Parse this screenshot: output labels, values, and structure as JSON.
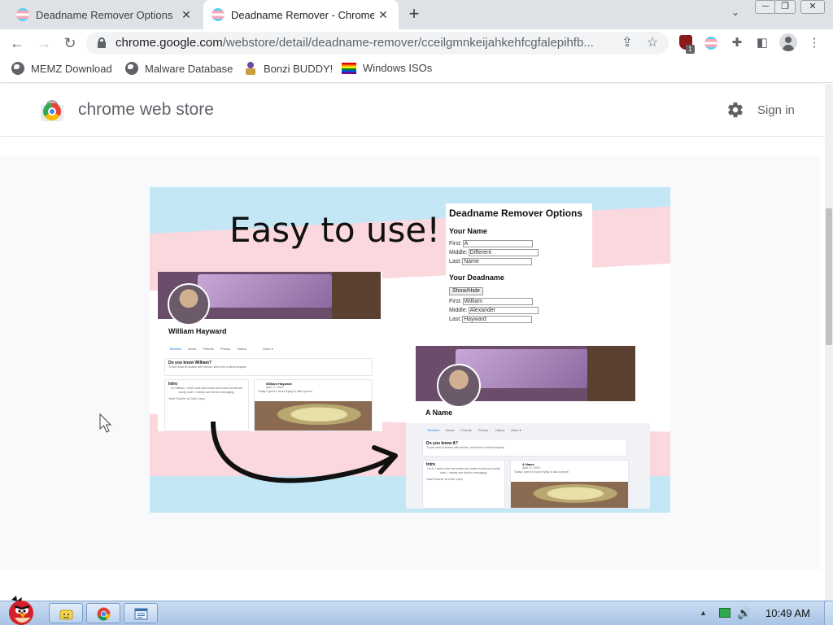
{
  "tabs": [
    {
      "title": "Deadname Remover Options",
      "active": false
    },
    {
      "title": "Deadname Remover - Chrome Web Store",
      "active": true
    }
  ],
  "toolbar": {
    "url_host": "chrome.google.com",
    "url_path": "/webstore/detail/deadname-remover/cceilgmnkeijahkehfcgfalepihfb...",
    "extension_badge": "1"
  },
  "bookmarks": [
    {
      "label": "MEMZ Download",
      "icon": "globe-icon"
    },
    {
      "label": "Malware Database",
      "icon": "globe-icon"
    },
    {
      "label": "Bonzi BUDDY!",
      "icon": "bonzi-icon"
    },
    {
      "label": "Windows ISOs",
      "icon": "rainbow-flag-icon"
    }
  ],
  "store": {
    "title": "chrome web store",
    "signin": "Sign in"
  },
  "promo": {
    "headline": "Easy to use!",
    "options": {
      "title": "Deadname Remover Options",
      "your_name": "Your Name",
      "first_label": "First:",
      "first_value": "A",
      "middle_label": "Middle:",
      "middle_value": "Different",
      "last_label": "Last:",
      "last_value": "Name",
      "your_deadname": "Your Deadname",
      "show_hide": "Show/Hide",
      "dead_first": "William",
      "dead_middle": "Alexander",
      "dead_last": "Hayward"
    },
    "profile_before": {
      "name": "William Hayward",
      "nav": [
        "Timeline",
        "About",
        "Friends",
        "Photos",
        "Videos",
        "More ▾"
      ],
      "know_title": "Do you know William?",
      "know_text": "To see what he shares with friends, send him a friend request.",
      "intro_title": "Intro",
      "intro_text": "I'm William. I write code and words and coded words and wordy code. I mainly use this for messaging.",
      "teacher": "Head Teacher at Code Camp",
      "post_name": "William Hayward",
      "post_date": "April 17, 2015",
      "post_text": "Today I spent 5 hours trying to dial a phone."
    },
    "profile_after": {
      "name": "A Name",
      "nav": [
        "Timeline",
        "About",
        "Friends",
        "Photos",
        "Videos",
        "More ▾"
      ],
      "know_title": "Do you know A?",
      "know_text": "To see what A shares with friends, send them a friend request.",
      "intro_title": "Intro",
      "intro_text": "I'm A. I write code and words and coded words and wordy code. I mainly use this for messaging.",
      "teacher": "Head Teacher at Code Camp",
      "post_name": "A Name",
      "post_date": "April 17, 2015",
      "post_text": "Today I spent 5 hours trying to dial a phone."
    }
  },
  "taskbar": {
    "clock": "10:49 AM"
  },
  "colors": {
    "tabstrip": "#dee1e6",
    "trans_blue": "#c4e7f6",
    "trans_pink": "#fbd7de",
    "link_blue": "#1877f2"
  }
}
